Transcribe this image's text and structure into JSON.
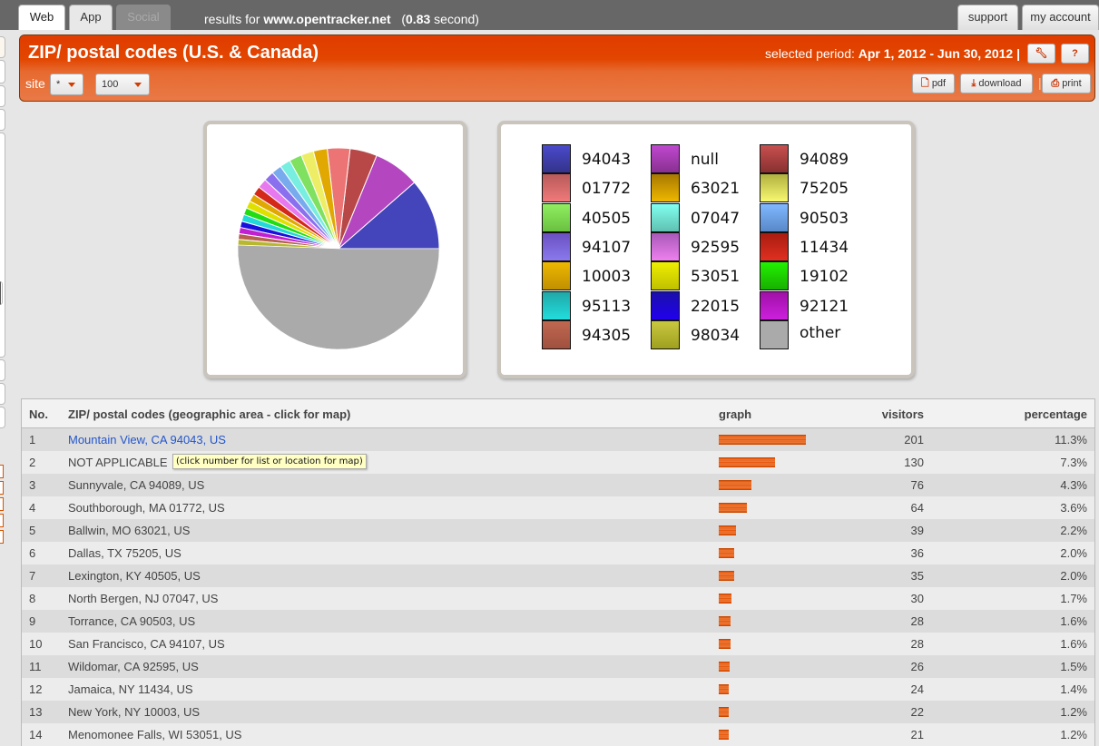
{
  "topbar": {
    "tabs": [
      {
        "label": "Web",
        "state": "active"
      },
      {
        "label": "App",
        "state": "normal"
      },
      {
        "label": "Social",
        "state": "disabled"
      }
    ],
    "results_prefix": "results for",
    "results_domain": "www.opentracker.net",
    "results_time_open": "(",
    "results_time_value": "0.83",
    "results_time_suffix": "second)",
    "support_label": "support",
    "account_label": "my account"
  },
  "header": {
    "title": "ZIP/ postal codes (U.S. & Canada)",
    "period_label": "selected period:",
    "period_value": "Apr 1, 2012 - Jun 30, 2012 |",
    "settings_icon": "wrench-icon",
    "help_label": "?",
    "site_label": "site",
    "site_select_value": "*",
    "count_select_value": "100",
    "pdf_label": "pdf",
    "download_label": "download",
    "separator": "|",
    "print_label": "print",
    "accent_color": "#e24600"
  },
  "chart_data": {
    "type": "pie",
    "title": "",
    "slices": [
      {
        "label": "94043",
        "value": 11.3,
        "color": "#4444bb"
      },
      {
        "label": "null",
        "value": 7.3,
        "color": "#b447c0"
      },
      {
        "label": "94089",
        "value": 4.3,
        "color": "#b84848"
      },
      {
        "label": "01772",
        "value": 3.6,
        "color": "#ec7474"
      },
      {
        "label": "63021",
        "value": 2.2,
        "color": "#e0a800"
      },
      {
        "label": "75205",
        "value": 2.0,
        "color": "#eeee66"
      },
      {
        "label": "40505",
        "value": 2.0,
        "color": "#80e060"
      },
      {
        "label": "07047",
        "value": 1.7,
        "color": "#78eee0"
      },
      {
        "label": "90503",
        "value": 1.6,
        "color": "#78aaee"
      },
      {
        "label": "94107",
        "value": 1.6,
        "color": "#8a70ee"
      },
      {
        "label": "92595",
        "value": 1.5,
        "color": "#e878ee"
      },
      {
        "label": "11434",
        "value": 1.4,
        "color": "#d42818"
      },
      {
        "label": "10003",
        "value": 1.2,
        "color": "#e0a800"
      },
      {
        "label": "53051",
        "value": 1.2,
        "color": "#e0e000"
      },
      {
        "label": "19102",
        "value": 1.1,
        "color": "#22dd11"
      },
      {
        "label": "95113",
        "value": 1.1,
        "color": "#22d8d8"
      },
      {
        "label": "22015",
        "value": 1.0,
        "color": "#1a10dd"
      },
      {
        "label": "92121",
        "value": 1.0,
        "color": "#c020d0"
      },
      {
        "label": "94305",
        "value": 0.9,
        "color": "#b86050"
      },
      {
        "label": "98034",
        "value": 0.9,
        "color": "#b8b830"
      },
      {
        "label": "other",
        "value": 50.0,
        "color": "#aaaaaa"
      }
    ],
    "legend_position": "right-panel",
    "legend": [
      {
        "label": "94043",
        "color_top": "#4a4acc",
        "color_bottom": "#33338a"
      },
      {
        "label": "01772",
        "color_top": "#b85a5a",
        "color_bottom": "#f07a7a"
      },
      {
        "label": "40505",
        "color_top": "#90ee60",
        "color_bottom": "#6ac040"
      },
      {
        "label": "94107",
        "color_top": "#6a50c0",
        "color_bottom": "#8a7aee"
      },
      {
        "label": "10003",
        "color_top": "#eeb800",
        "color_bottom": "#c09000"
      },
      {
        "label": "95113",
        "color_top": "#20a8a8",
        "color_bottom": "#22dddd"
      },
      {
        "label": "94305",
        "color_top": "#c06850",
        "color_bottom": "#a05040"
      },
      {
        "label": "null",
        "color_top": "#c048d0",
        "color_bottom": "#883090"
      },
      {
        "label": "63021",
        "color_top": "#a87800",
        "color_bottom": "#eeb800"
      },
      {
        "label": "07047",
        "color_top": "#80fff0",
        "color_bottom": "#60c0b0"
      },
      {
        "label": "92595",
        "color_top": "#a858b8",
        "color_bottom": "#ee80ee"
      },
      {
        "label": "53051",
        "color_top": "#eeee00",
        "color_bottom": "#c0c000"
      },
      {
        "label": "22015",
        "color_top": "#1a10aa",
        "color_bottom": "#2200ee"
      },
      {
        "label": "98034",
        "color_top": "#c8c840",
        "color_bottom": "#a0a020"
      },
      {
        "label": "94089",
        "color_top": "#c85050",
        "color_bottom": "#883030"
      },
      {
        "label": "75205",
        "color_top": "#b0b040",
        "color_bottom": "#f8f870"
      },
      {
        "label": "90503",
        "color_top": "#80b8ff",
        "color_bottom": "#5888c8"
      },
      {
        "label": "11434",
        "color_top": "#a81c10",
        "color_bottom": "#e03020"
      },
      {
        "label": "19102",
        "color_top": "#22f000",
        "color_bottom": "#18b000"
      },
      {
        "label": "92121",
        "color_top": "#a010a8",
        "color_bottom": "#cc20dd"
      },
      {
        "label": "other",
        "color_top": "#aaaaaa",
        "color_bottom": "#aaaaaa"
      }
    ]
  },
  "table": {
    "headers": {
      "no": "No.",
      "location": "ZIP/ postal codes (geographic area - click for map)",
      "graph": "graph",
      "visitors": "visitors",
      "percentage": "percentage"
    },
    "max_visitors": 201,
    "rows": [
      {
        "no": "1",
        "location": "Mountain View, CA 94043, US",
        "visitors": "201",
        "percentage": "11.3%",
        "link": true
      },
      {
        "no": "2",
        "location": "NOT APPLICABLE",
        "visitors": "130",
        "percentage": "7.3%",
        "link": false
      },
      {
        "no": "3",
        "location": "Sunnyvale, CA 94089, US",
        "visitors": "76",
        "percentage": "4.3%",
        "link": false
      },
      {
        "no": "4",
        "location": "Southborough, MA 01772, US",
        "visitors": "64",
        "percentage": "3.6%",
        "link": false
      },
      {
        "no": "5",
        "location": "Ballwin, MO 63021, US",
        "visitors": "39",
        "percentage": "2.2%",
        "link": false
      },
      {
        "no": "6",
        "location": "Dallas, TX 75205, US",
        "visitors": "36",
        "percentage": "2.0%",
        "link": false
      },
      {
        "no": "7",
        "location": "Lexington, KY 40505, US",
        "visitors": "35",
        "percentage": "2.0%",
        "link": false
      },
      {
        "no": "8",
        "location": "North Bergen, NJ 07047, US",
        "visitors": "30",
        "percentage": "1.7%",
        "link": false
      },
      {
        "no": "9",
        "location": "Torrance, CA 90503, US",
        "visitors": "28",
        "percentage": "1.6%",
        "link": false
      },
      {
        "no": "10",
        "location": "San Francisco, CA 94107, US",
        "visitors": "28",
        "percentage": "1.6%",
        "link": false
      },
      {
        "no": "11",
        "location": "Wildomar, CA 92595, US",
        "visitors": "26",
        "percentage": "1.5%",
        "link": false
      },
      {
        "no": "12",
        "location": "Jamaica, NY 11434, US",
        "visitors": "24",
        "percentage": "1.4%",
        "link": false
      },
      {
        "no": "13",
        "location": "New York, NY 10003, US",
        "visitors": "22",
        "percentage": "1.2%",
        "link": false
      },
      {
        "no": "14",
        "location": "Menomonee Falls, WI 53051, US",
        "visitors": "21",
        "percentage": "1.2%",
        "link": false
      }
    ]
  },
  "tooltip": {
    "text": "(click number for list or location for map)"
  }
}
